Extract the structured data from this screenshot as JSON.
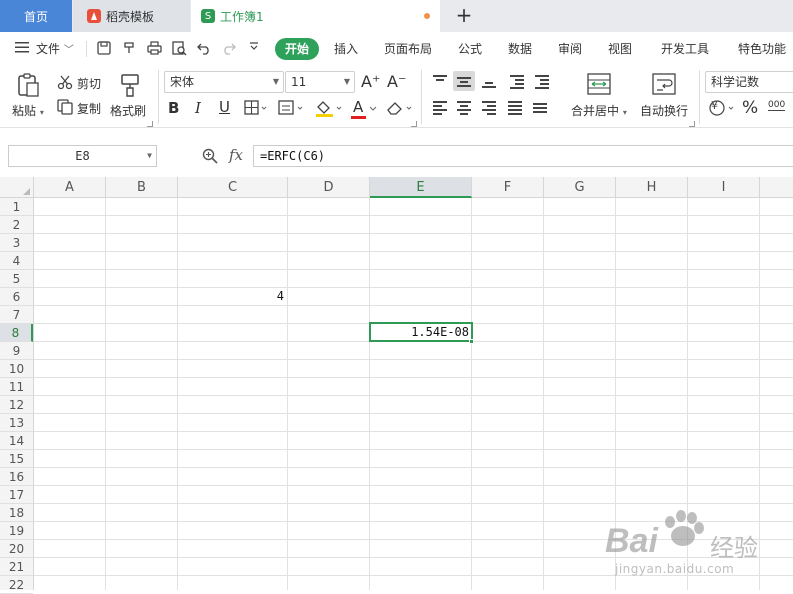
{
  "tabs": {
    "home": "首页",
    "shell": "稻壳模板",
    "workbook": "工作簿1",
    "workbook_icon": "S",
    "new_tab": "+"
  },
  "menu": {
    "file": "文件",
    "items": [
      "开始",
      "插入",
      "页面布局",
      "公式",
      "数据",
      "审阅",
      "视图",
      "开发工具",
      "特色功能"
    ]
  },
  "ribbon": {
    "paste": "粘贴",
    "cut": "剪切",
    "copy": "复制",
    "format_painter": "格式刷",
    "font_name": "宋体",
    "font_size": "11",
    "grow_font": "A⁺",
    "shrink_font": "A⁻",
    "bold": "B",
    "italic": "I",
    "underline": "U",
    "font_color_letter": "A",
    "merge_center": "合并居中",
    "wrap_text": "自动换行",
    "number_format": "科学记数",
    "percent": "%",
    "thousands": "000",
    "currency": "¥"
  },
  "formula_bar": {
    "name_box": "E8",
    "fx": "fx",
    "formula": "=ERFC(C6)"
  },
  "grid": {
    "columns": [
      "A",
      "B",
      "C",
      "D",
      "E",
      "F",
      "G",
      "H",
      "I"
    ],
    "rows": [
      "1",
      "2",
      "3",
      "4",
      "5",
      "6",
      "7",
      "8",
      "9",
      "10",
      "11",
      "12",
      "13",
      "14",
      "15",
      "16",
      "17",
      "18",
      "19",
      "20",
      "21",
      "22"
    ],
    "active_column": "E",
    "active_row": "8",
    "cells": {
      "C6": "4",
      "E8": "1.54E-08"
    }
  },
  "watermark": {
    "brand": "Bai",
    "brand_suffix": "经验",
    "url": "jingyan.baidu.com"
  },
  "colors": {
    "accent_green": "#2e9a55",
    "home_tab_blue": "#4a86d8"
  }
}
